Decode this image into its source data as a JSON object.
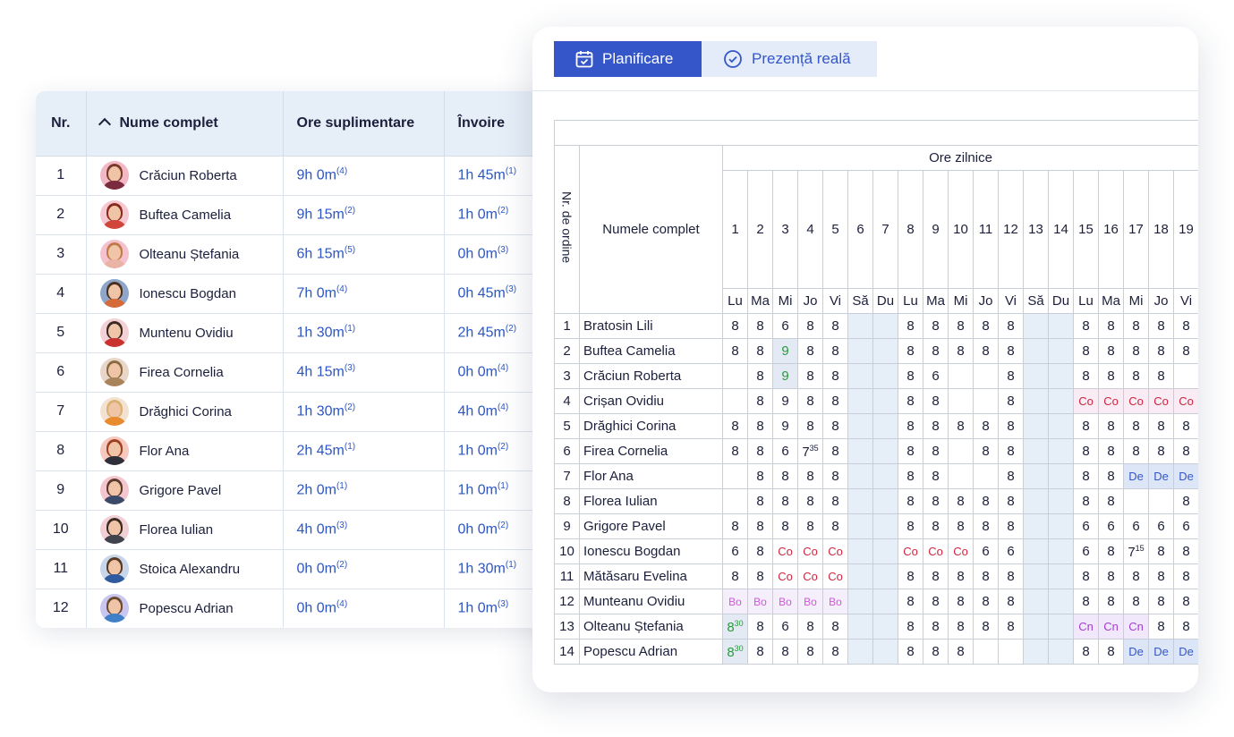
{
  "left": {
    "headers": {
      "nr": "Nr.",
      "name": "Nume complet",
      "overtime": "Ore suplimentare",
      "leave": "Învoire"
    },
    "rows": [
      {
        "nr": "1",
        "name": "Crăciun Roberta",
        "ot": "9h 0m",
        "ot_n": "(4)",
        "lv": "1h 45m",
        "lv_n": "(1)"
      },
      {
        "nr": "2",
        "name": "Buftea Camelia",
        "ot": "9h 15m",
        "ot_n": "(2)",
        "lv": "1h 0m",
        "lv_n": "(2)"
      },
      {
        "nr": "3",
        "name": "Olteanu Ștefania",
        "ot": "6h 15m",
        "ot_n": "(5)",
        "lv": "0h 0m",
        "lv_n": "(3)"
      },
      {
        "nr": "4",
        "name": "Ionescu Bogdan",
        "ot": "7h 0m",
        "ot_n": "(4)",
        "lv": "0h 45m",
        "lv_n": "(3)"
      },
      {
        "nr": "5",
        "name": "Muntenu Ovidiu",
        "ot": "1h 30m",
        "ot_n": "(1)",
        "lv": "2h 45m",
        "lv_n": "(2)"
      },
      {
        "nr": "6",
        "name": "Firea Cornelia",
        "ot": "4h 15m",
        "ot_n": "(3)",
        "lv": "0h 0m",
        "lv_n": "(4)"
      },
      {
        "nr": "7",
        "name": "Drăghici Corina",
        "ot": "1h 30m",
        "ot_n": "(2)",
        "lv": "4h 0m",
        "lv_n": "(4)"
      },
      {
        "nr": "8",
        "name": "Flor Ana",
        "ot": "2h 45m",
        "ot_n": "(1)",
        "lv": "1h 0m",
        "lv_n": "(2)"
      },
      {
        "nr": "9",
        "name": "Grigore Pavel",
        "ot": "2h 0m",
        "ot_n": "(1)",
        "lv": "1h 0m",
        "lv_n": "(1)"
      },
      {
        "nr": "10",
        "name": "Florea Iulian",
        "ot": "4h 0m",
        "ot_n": "(3)",
        "lv": "0h 0m",
        "lv_n": "(2)"
      },
      {
        "nr": "11",
        "name": "Stoica Alexandru",
        "ot": "0h 0m",
        "ot_n": "(2)",
        "lv": "1h 30m",
        "lv_n": "(1)"
      },
      {
        "nr": "12",
        "name": "Popescu Adrian",
        "ot": "0h 0m",
        "ot_n": "(4)",
        "lv": "1h 0m",
        "lv_n": "(3)"
      }
    ]
  },
  "avatars": [
    {
      "bg": "#f2b8c6",
      "hair": "#7a3a2a",
      "shirt": "#7b2b3f"
    },
    {
      "bg": "#f6c9d2",
      "hair": "#8b2a1d",
      "shirt": "#d0463b"
    },
    {
      "bg": "#f4c2cf",
      "hair": "#c07a4a",
      "shirt": "#e9b4a6"
    },
    {
      "bg": "#8fa6c8",
      "hair": "#4a3020",
      "shirt": "#d66b3a"
    },
    {
      "bg": "#f3d0d6",
      "hair": "#3a2a22",
      "shirt": "#c8322f"
    },
    {
      "bg": "#e8d6c8",
      "hair": "#8a6a40",
      "shirt": "#a9845b"
    },
    {
      "bg": "#f3e2d2",
      "hair": "#d8b070",
      "shirt": "#e88a2e"
    },
    {
      "bg": "#f5c9c0",
      "hair": "#a0401e",
      "shirt": "#2f2f3a"
    },
    {
      "bg": "#f4c7d0",
      "hair": "#5a3a2a",
      "shirt": "#3c4a6a"
    },
    {
      "bg": "#f2cfd4",
      "hair": "#3a2a20",
      "shirt": "#40424c"
    },
    {
      "bg": "#c8d6ea",
      "hair": "#5a3a25",
      "shirt": "#2f5aa0"
    },
    {
      "bg": "#c9c6ef",
      "hair": "#6a4a30",
      "shirt": "#3f80c9"
    }
  ],
  "right": {
    "tabs": {
      "planning": "Planificare",
      "attendance": "Prezență reală"
    },
    "headers": {
      "nr": "Nr. de ordine",
      "name": "Numele complet",
      "daily": "Ore zilnice"
    },
    "days": [
      "1",
      "2",
      "3",
      "4",
      "5",
      "6",
      "7",
      "8",
      "9",
      "10",
      "11",
      "12",
      "13",
      "14",
      "15",
      "16",
      "17",
      "18",
      "19"
    ],
    "weekdays": [
      "Lu",
      "Ma",
      "Mi",
      "Jo",
      "Vi",
      "Să",
      "Du",
      "Lu",
      "Ma",
      "Mi",
      "Jo",
      "Vi",
      "Să",
      "Du",
      "Lu",
      "Ma",
      "Mi",
      "Jo",
      "Vi"
    ],
    "rows": [
      {
        "nr": "1",
        "name": "Bratosin Lili",
        "cells": [
          "8",
          "8",
          "6",
          "8",
          "8",
          "",
          "",
          "8",
          "8",
          "8",
          "8",
          "8",
          "",
          "",
          "8",
          "8",
          "8",
          "8",
          "8"
        ]
      },
      {
        "nr": "2",
        "name": "Buftea Camelia",
        "cells": [
          "8",
          "8",
          "9",
          "8",
          "8",
          "",
          "",
          "8",
          "8",
          "8",
          "8",
          "8",
          "",
          "",
          "8",
          "8",
          "8",
          "8",
          "8"
        ]
      },
      {
        "nr": "3",
        "name": "Crăciun Roberta",
        "cells": [
          "",
          "8",
          "9",
          "8",
          "8",
          "",
          "",
          "8",
          "6",
          "",
          "",
          "8",
          "",
          "",
          "8",
          "8",
          "8",
          "8",
          ""
        ]
      },
      {
        "nr": "4",
        "name": "Crișan Ovidiu",
        "cells": [
          "",
          "8",
          "9",
          "8",
          "8",
          "",
          "",
          "8",
          "8",
          "",
          "",
          "8",
          "",
          "",
          "Co",
          "Co",
          "Co",
          "Co",
          "Co"
        ]
      },
      {
        "nr": "5",
        "name": "Drăghici Corina",
        "cells": [
          "8",
          "8",
          "9",
          "8",
          "8",
          "",
          "",
          "8",
          "8",
          "8",
          "8",
          "8",
          "",
          "",
          "8",
          "8",
          "8",
          "8",
          "8"
        ]
      },
      {
        "nr": "6",
        "name": "Firea Cornelia",
        "cells": [
          "8",
          "8",
          "6",
          "7|35",
          "8",
          "",
          "",
          "8",
          "8",
          "",
          "8",
          "8",
          "",
          "",
          "8",
          "8",
          "8",
          "8",
          "8"
        ]
      },
      {
        "nr": "7",
        "name": "Flor Ana",
        "cells": [
          "",
          "8",
          "8",
          "8",
          "8",
          "",
          "",
          "8",
          "8",
          "",
          "",
          "8",
          "",
          "",
          "8",
          "8",
          "De",
          "De",
          "De"
        ]
      },
      {
        "nr": "8",
        "name": "Florea Iulian",
        "cells": [
          "",
          "8",
          "8",
          "8",
          "8",
          "",
          "",
          "8",
          "8",
          "8",
          "8",
          "8",
          "",
          "",
          "8",
          "8",
          "",
          "",
          "8"
        ]
      },
      {
        "nr": "9",
        "name": "Grigore Pavel",
        "cells": [
          "8",
          "8",
          "8",
          "8",
          "8",
          "",
          "",
          "8",
          "8",
          "8",
          "8",
          "8",
          "",
          "",
          "6",
          "6",
          "6",
          "6",
          "6"
        ]
      },
      {
        "nr": "10",
        "name": "Ionescu Bogdan",
        "cells": [
          "6",
          "8",
          "Co",
          "Co",
          "Co",
          "",
          "",
          "Co",
          "Co",
          "Co",
          "6",
          "6",
          "",
          "",
          "6",
          "8",
          "7|15",
          "8",
          "8"
        ]
      },
      {
        "nr": "11",
        "name": "Mătăsaru Evelina",
        "cells": [
          "8",
          "8",
          "Co",
          "Co",
          "Co",
          "",
          "",
          "8",
          "8",
          "8",
          "8",
          "8",
          "",
          "",
          "8",
          "8",
          "8",
          "8",
          "8"
        ]
      },
      {
        "nr": "12",
        "name": "Munteanu Ovidiu",
        "cells": [
          "Bo",
          "Bo",
          "Bo",
          "Bo",
          "Bo",
          "",
          "",
          "8",
          "8",
          "8",
          "8",
          "8",
          "",
          "",
          "8",
          "8",
          "8",
          "8",
          "8"
        ]
      },
      {
        "nr": "13",
        "name": "Olteanu Ștefania",
        "cells": [
          "8|30",
          "8",
          "6",
          "8",
          "8",
          "",
          "",
          "8",
          "8",
          "8",
          "8",
          "8",
          "",
          "",
          "Cn",
          "Cn",
          "Cn",
          "8",
          "8"
        ]
      },
      {
        "nr": "14",
        "name": "Popescu Adrian",
        "cells": [
          "8|30",
          "8",
          "8",
          "8",
          "8",
          "",
          "",
          "8",
          "8",
          "8",
          "",
          "",
          "",
          "",
          "8",
          "8",
          "De",
          "De",
          "De"
        ]
      }
    ]
  },
  "colors": {
    "accent": "#3556c9",
    "value_blue": "#2c56c4",
    "header_bg": "#e6eef8",
    "co_red": "#d0253f",
    "bo_pink": "#d257dc",
    "cn_purple": "#a13fd1",
    "green": "#2a9a3d"
  },
  "icons": {
    "planning": "calendar-check-icon",
    "attendance": "check-circle-icon",
    "sort": "chevron-up-icon"
  }
}
